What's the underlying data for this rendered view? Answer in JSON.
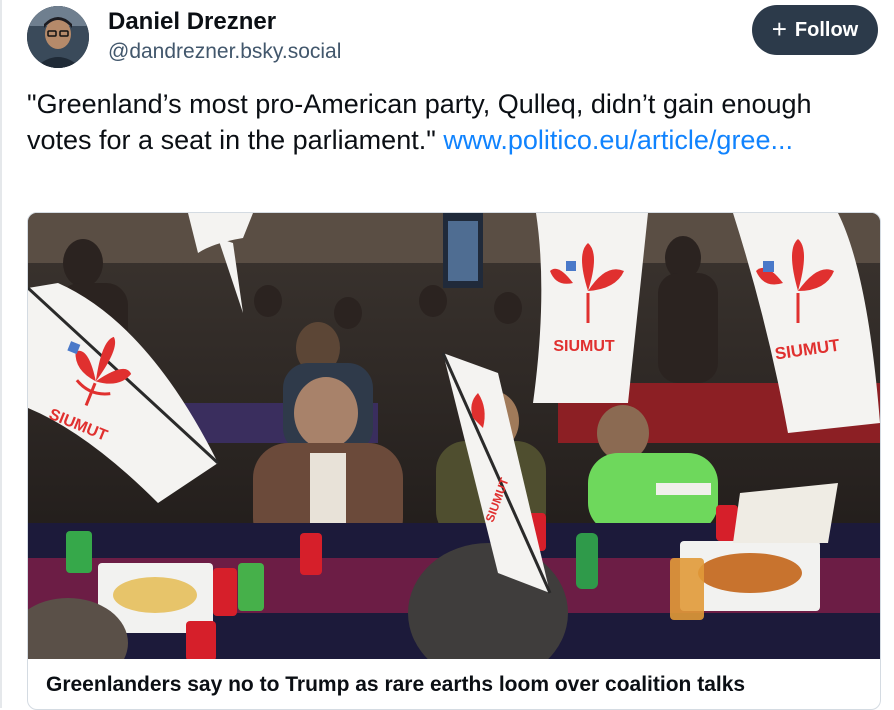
{
  "author": {
    "display_name": "Daniel Drezner",
    "handle": "@dandrezner.bsky.social"
  },
  "actions": {
    "follow_label": "Follow"
  },
  "post": {
    "text": "\"Greenland’s most pro-American party, Qulleq, didn’t gain enough votes for a seat in the parliament.\" ",
    "link_text": "www.politico.eu/article/gree..."
  },
  "card": {
    "image_banner_text": "SIUMUT",
    "title": "Greenlanders say no to Trump as rare earths loom over coalition talks"
  },
  "colors": {
    "follow_bg": "#2c3a4a",
    "link": "#1083fe",
    "siumut_red": "#e0302f"
  }
}
